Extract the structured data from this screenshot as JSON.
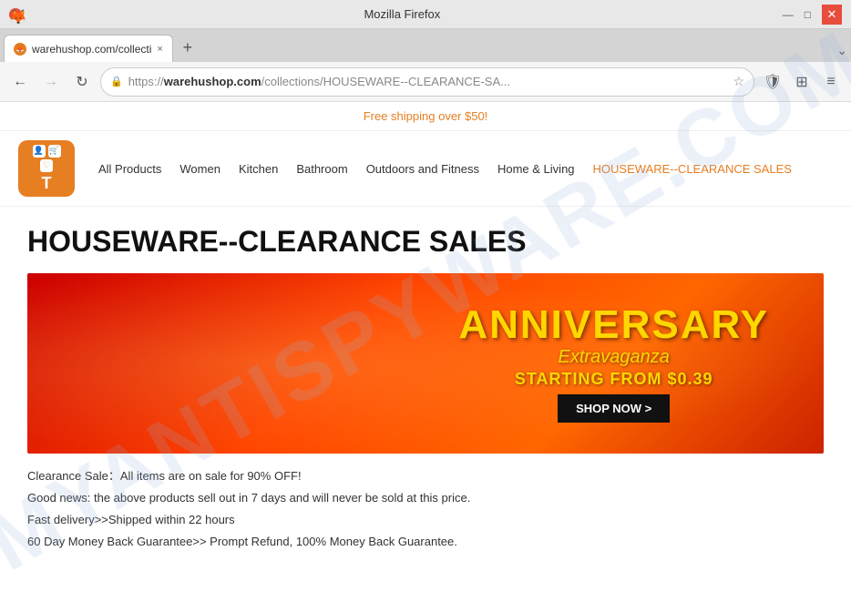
{
  "browser": {
    "title": "Mozilla Firefox",
    "favicon": "🦊",
    "tab": {
      "label": "warehushop.com/collecti",
      "close": "×"
    },
    "nav": {
      "back_label": "←",
      "forward_label": "→",
      "reload_label": "↻",
      "url_protocol": "https://",
      "url_domain": "warehushop.com",
      "url_path": "/collections/HOUSEWARE--CLEARANCE-SA...",
      "star_label": "☆",
      "shield_label": "🛡",
      "extensions_label": "⊞",
      "more_label": "≡",
      "new_tab_label": "+",
      "tab_arrow_label": "⌄",
      "lock_label": "🔒"
    },
    "window_controls": {
      "minimize": "—",
      "maximize": "□",
      "close": "✕"
    }
  },
  "shipping_banner": {
    "text": "Free shipping over $50!"
  },
  "site": {
    "logo_icons": [
      "👤",
      "🛒",
      "♡"
    ],
    "logo_letter": "T",
    "nav_items": [
      {
        "label": "All Products",
        "id": "all-products"
      },
      {
        "label": "Women",
        "id": "women"
      },
      {
        "label": "Kitchen",
        "id": "kitchen"
      },
      {
        "label": "Bathroom",
        "id": "bathroom"
      },
      {
        "label": "Outdoors and Fitness",
        "id": "outdoors"
      },
      {
        "label": "Home & Living",
        "id": "home-living"
      },
      {
        "label": "HOUSEWARE--CLEARANCE SALES",
        "id": "clearance",
        "active": true
      }
    ]
  },
  "page": {
    "title": "HOUSEWARE--CLEARANCE SALES",
    "banner": {
      "line1": "ANNIVERSARY",
      "line2": "Extravaganza",
      "line3": "STARTING FROM $0.39",
      "cta": "SHOP NOW >"
    },
    "description": [
      "Clearance Sale：All items are on sale for 90% OFF!",
      "Good news: the above products sell out in 7 days and will never be sold at this price.",
      "Fast delivery>>Shipped within 22 hours",
      "60 Day Money Back Guarantee>> Prompt Refund, 100% Money Back Guarantee."
    ]
  },
  "watermark": "MYANTISPYWARE.COM"
}
